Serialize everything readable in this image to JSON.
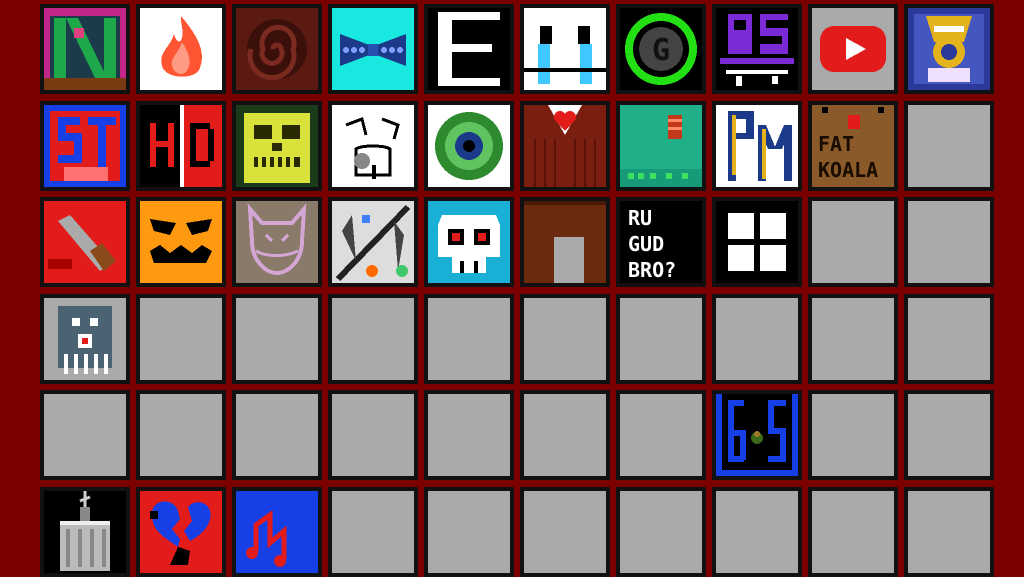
{
  "palette": {
    "background": "#7a0000",
    "empty_slot": "#aaaaaa",
    "slot_border": "#111111"
  },
  "rows": [
    [
      {
        "icon": "glitch-n-icon"
      },
      {
        "icon": "flame-icon"
      },
      {
        "icon": "spiral-icon"
      },
      {
        "icon": "bowtie-icon"
      },
      {
        "icon": "letter-e-icon",
        "text": "E"
      },
      {
        "icon": "crying-face-icon"
      },
      {
        "icon": "green-g-icon",
        "text": "G"
      },
      {
        "icon": "purple-ps-icon",
        "text": "PS"
      },
      {
        "icon": "play-button-icon"
      },
      {
        "icon": "gold-crest-icon"
      }
    ],
    [
      {
        "icon": "red-st-icon",
        "text": "ST"
      },
      {
        "icon": "hd-icon",
        "text": "HD"
      },
      {
        "icon": "yellow-skull-icon"
      },
      {
        "icon": "sketch-face-icon"
      },
      {
        "icon": "green-eye-icon"
      },
      {
        "icon": "vest-heart-icon"
      },
      {
        "icon": "teal-can-icon"
      },
      {
        "icon": "pm-letters-icon",
        "text": "PM"
      },
      {
        "icon": "fat-koala-icon",
        "line1": "FAT",
        "line2": "KOALA"
      },
      {
        "icon": "empty"
      }
    ],
    [
      {
        "icon": "bloody-knife-icon"
      },
      {
        "icon": "pumpkin-face-icon"
      },
      {
        "icon": "cat-outline-icon"
      },
      {
        "icon": "diagonal-art-icon"
      },
      {
        "icon": "white-skull-icon"
      },
      {
        "icon": "door-icon"
      },
      {
        "icon": "ru-gud-bro-icon",
        "lines": [
          "RU",
          "GUD",
          "BRO?"
        ]
      },
      {
        "icon": "window-icon"
      },
      {
        "icon": "empty"
      },
      {
        "icon": "empty"
      }
    ],
    [
      {
        "icon": "ghost-icon"
      },
      {
        "icon": "empty"
      },
      {
        "icon": "empty"
      },
      {
        "icon": "empty"
      },
      {
        "icon": "empty"
      },
      {
        "icon": "empty"
      },
      {
        "icon": "empty"
      },
      {
        "icon": "empty"
      },
      {
        "icon": "empty"
      },
      {
        "icon": "empty"
      }
    ],
    [
      {
        "icon": "empty"
      },
      {
        "icon": "empty"
      },
      {
        "icon": "empty"
      },
      {
        "icon": "empty"
      },
      {
        "icon": "empty"
      },
      {
        "icon": "empty"
      },
      {
        "icon": "empty"
      },
      {
        "icon": "six-five-bug-icon",
        "text": "65"
      },
      {
        "icon": "empty"
      },
      {
        "icon": "empty"
      }
    ],
    [
      {
        "icon": "hanging-jar-icon"
      },
      {
        "icon": "broken-heart-icon"
      },
      {
        "icon": "music-note-icon"
      },
      {
        "icon": "empty"
      },
      {
        "icon": "empty"
      },
      {
        "icon": "empty"
      },
      {
        "icon": "empty"
      },
      {
        "icon": "empty"
      },
      {
        "icon": "empty"
      },
      {
        "icon": "empty"
      }
    ]
  ]
}
